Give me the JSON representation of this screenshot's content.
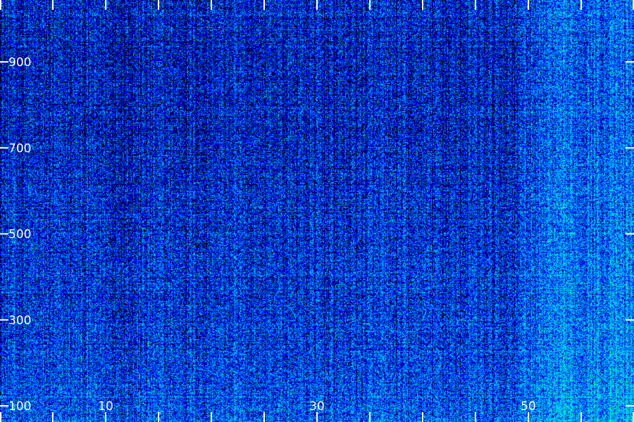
{
  "chart_data": {
    "type": "heatmap",
    "title": "",
    "xlabel": "",
    "ylabel": "",
    "xlim": [
      0,
      60
    ],
    "ylim": [
      100,
      1000
    ],
    "x_tick_labels": [
      {
        "value": 10,
        "label": "10"
      },
      {
        "value": 30,
        "label": "30"
      },
      {
        "value": 50,
        "label": "50"
      }
    ],
    "x_ticks": [
      0,
      5,
      10,
      15,
      20,
      25,
      30,
      35,
      40,
      45,
      50,
      55,
      60
    ],
    "y_tick_labels": [
      {
        "value": 100,
        "label": "100"
      },
      {
        "value": 300,
        "label": "300"
      },
      {
        "value": 500,
        "label": "500"
      },
      {
        "value": 700,
        "label": "700"
      },
      {
        "value": 900,
        "label": "900"
      }
    ],
    "colormap": [
      "#000000",
      "#00008b",
      "#0000ff",
      "#0096ff",
      "#00c8ff",
      "#00ffc8",
      "#00ff50"
    ],
    "value_range": [
      0,
      1
    ],
    "grid": false,
    "legend": "none",
    "intensity_profile": {
      "description_x": "intensity rises sharply past x≈50",
      "x_breakpoints": [
        0,
        48,
        50,
        52,
        58,
        60
      ],
      "x_levels": [
        0.32,
        0.34,
        0.5,
        0.58,
        0.62,
        0.68
      ],
      "y_breakpoints": [
        100,
        200,
        300,
        500,
        700,
        900,
        1000
      ],
      "y_levels": [
        0.5,
        0.42,
        0.4,
        0.35,
        0.3,
        0.28,
        0.3
      ]
    }
  }
}
